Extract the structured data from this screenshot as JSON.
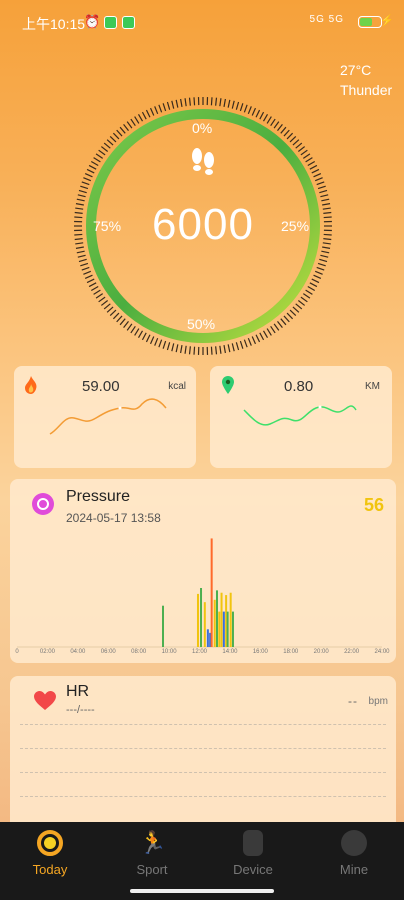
{
  "status_bar": {
    "time": "上午10:15",
    "network": "5G 5G"
  },
  "weather": {
    "temp": "27°C",
    "condition": "Thunder"
  },
  "steps": {
    "value": "6000",
    "pct_top": "0%",
    "pct_right": "25%",
    "pct_bottom": "50%",
    "pct_left": "75%",
    "progress": 1.0
  },
  "calories": {
    "value": "59.00",
    "unit": "kcal"
  },
  "distance": {
    "value": "0.80",
    "unit": "KM"
  },
  "pressure": {
    "title": "Pressure",
    "datetime": "2024-05-17 13:58",
    "value": "56",
    "axis_labels": [
      "0",
      "02:00",
      "04:00",
      "06:00",
      "08:00",
      "10:00",
      "12:00",
      "14:00",
      "16:00",
      "18:00",
      "20:00",
      "22:00",
      "24:00"
    ]
  },
  "chart_data": {
    "type": "bar",
    "title": "Pressure",
    "x_unit": "hour",
    "xlim": [
      0,
      24
    ],
    "ylim": [
      0,
      100
    ],
    "bars": [
      {
        "x": 9.6,
        "value": 35,
        "color": "#4caf50"
      },
      {
        "x": 11.9,
        "value": 45,
        "color": "#f1c40f"
      },
      {
        "x": 12.1,
        "value": 50,
        "color": "#4caf50"
      },
      {
        "x": 12.35,
        "value": 38,
        "color": "#f1c40f"
      },
      {
        "x": 12.55,
        "value": 15,
        "color": "#3b6fd8"
      },
      {
        "x": 12.7,
        "value": 12,
        "color": "#3b6fd8"
      },
      {
        "x": 12.8,
        "value": 92,
        "color": "#ff6a2b"
      },
      {
        "x": 13.0,
        "value": 40,
        "color": "#f1c40f"
      },
      {
        "x": 13.15,
        "value": 48,
        "color": "#4caf50"
      },
      {
        "x": 13.3,
        "value": 30,
        "color": "#f1c40f"
      },
      {
        "x": 13.45,
        "value": 46,
        "color": "#f1c40f"
      },
      {
        "x": 13.6,
        "value": 30,
        "color": "#3b6fd8"
      },
      {
        "x": 13.75,
        "value": 44,
        "color": "#f1c40f"
      },
      {
        "x": 13.85,
        "value": 30,
        "color": "#4caf50"
      },
      {
        "x": 14.05,
        "value": 46,
        "color": "#f1c40f"
      },
      {
        "x": 14.2,
        "value": 30,
        "color": "#4caf50"
      }
    ]
  },
  "hr": {
    "title": "HR",
    "subtitle": "---/----",
    "value": "--",
    "unit": "bpm"
  },
  "nav": {
    "today": "Today",
    "sport": "Sport",
    "device": "Device",
    "mine": "Mine"
  }
}
